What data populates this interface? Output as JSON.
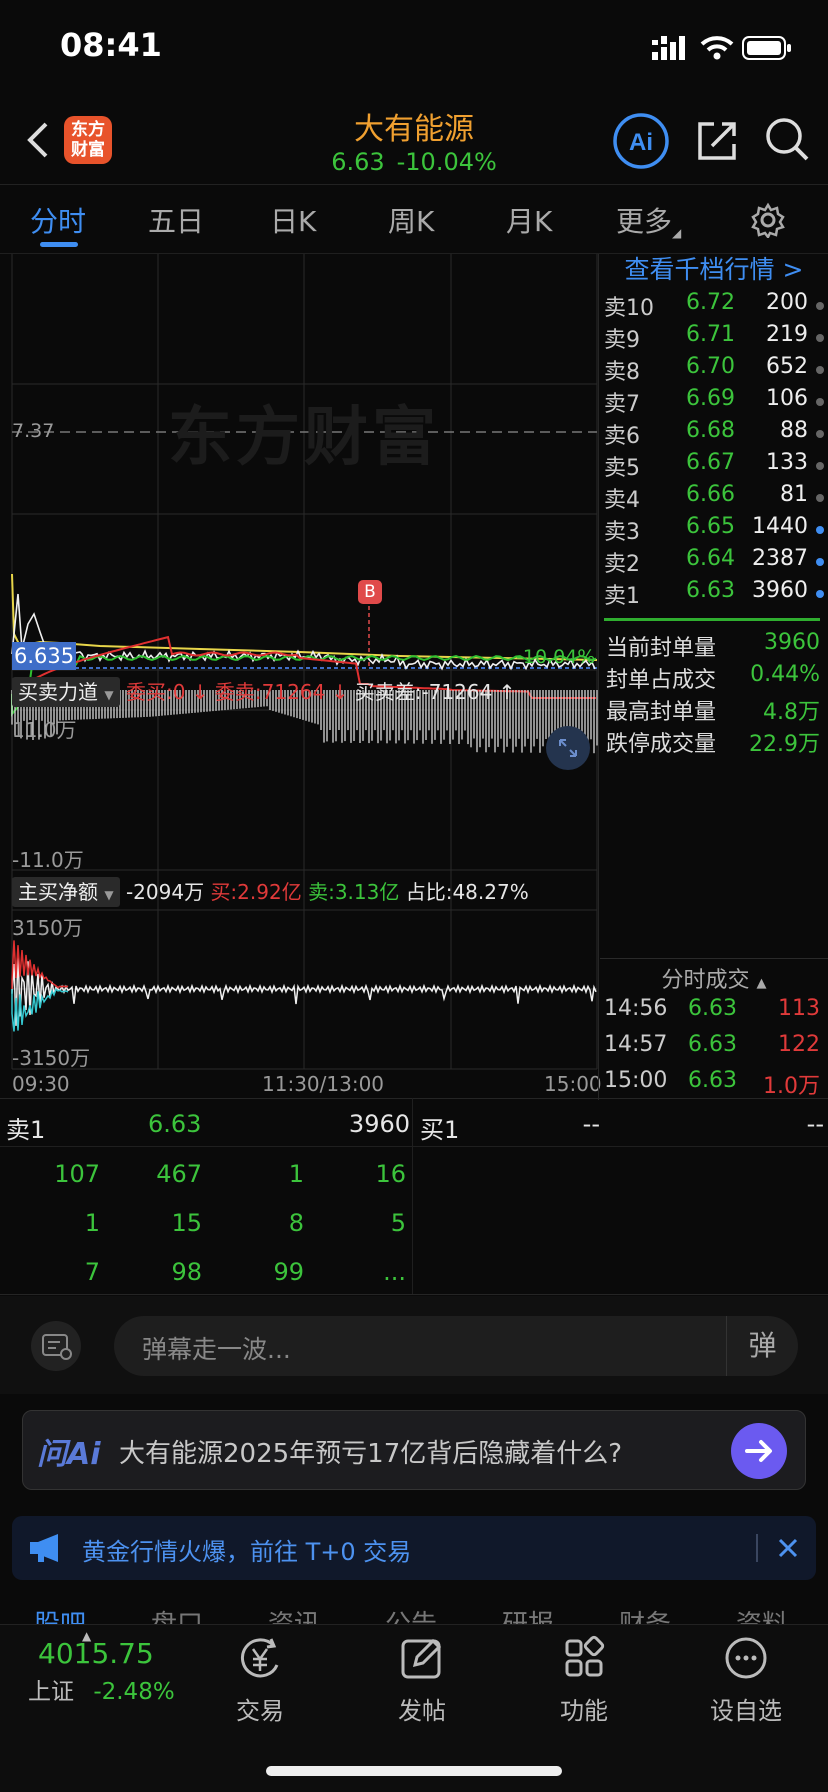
{
  "status_bar": {
    "time": "08:41"
  },
  "header": {
    "logo_text": "东方财富",
    "title": "大有能源",
    "price": "6.63",
    "change_pct": "-10.04%"
  },
  "tabs": [
    {
      "label": "分时",
      "active": true
    },
    {
      "label": "五日"
    },
    {
      "label": "日K"
    },
    {
      "label": "周K"
    },
    {
      "label": "月K"
    },
    {
      "label": "更多"
    }
  ],
  "chart": {
    "watermark": "东方财富",
    "ref_price_label": "7.37",
    "current_price_label": "6.635",
    "current_pct_label": "-10.04%",
    "marker": "B",
    "force_panel": {
      "name": "买卖力道",
      "commission_buy": "委买:0 ↓",
      "commission_sell": "委卖:71264 ↓",
      "diff": "买卖差:-71264 ↑",
      "top_label": "11.0万",
      "bottom_label": "-11.0万"
    },
    "net_panel": {
      "name": "主买净额",
      "net": "-2094万",
      "buy": "买:2.92亿",
      "sell": "卖:3.13亿",
      "ratio": "占比:48.27%",
      "top_label": "3150万",
      "bottom_label": "-3150万"
    },
    "time_axis": [
      "09:30",
      "11:30/13:00",
      "15:00"
    ]
  },
  "order_book": {
    "header": "查看千档行情 >",
    "rows": [
      {
        "label": "卖10",
        "price": "6.72",
        "vol": "200",
        "dot": "gray"
      },
      {
        "label": "卖9",
        "price": "6.71",
        "vol": "219",
        "dot": "gray"
      },
      {
        "label": "卖8",
        "price": "6.70",
        "vol": "652",
        "dot": "gray"
      },
      {
        "label": "卖7",
        "price": "6.69",
        "vol": "106",
        "dot": "gray"
      },
      {
        "label": "卖6",
        "price": "6.68",
        "vol": "88",
        "dot": "gray"
      },
      {
        "label": "卖5",
        "price": "6.67",
        "vol": "133",
        "dot": "gray"
      },
      {
        "label": "卖4",
        "price": "6.66",
        "vol": "81",
        "dot": "gray"
      },
      {
        "label": "卖3",
        "price": "6.65",
        "vol": "1440",
        "dot": "blue"
      },
      {
        "label": "卖2",
        "price": "6.64",
        "vol": "2387",
        "dot": "blue"
      },
      {
        "label": "卖1",
        "price": "6.63",
        "vol": "3960",
        "dot": "blue"
      }
    ],
    "stats": [
      {
        "k": "当前封单量",
        "v": "3960"
      },
      {
        "k": "封单占成交",
        "v": "0.44%"
      },
      {
        "k": "最高封单量",
        "v": "4.8万"
      },
      {
        "k": "跌停成交量",
        "v": "22.9万"
      }
    ]
  },
  "ticks": {
    "header": "分时成交",
    "rows": [
      {
        "t": "14:56",
        "p": "6.63",
        "q": "113"
      },
      {
        "t": "14:57",
        "p": "6.63",
        "q": "122"
      },
      {
        "t": "15:00",
        "p": "6.63",
        "q": "1.0万"
      }
    ]
  },
  "level2": {
    "sell1_label": "卖1",
    "sell1_price": "6.63",
    "sell1_vol": "3960",
    "buy1_label": "买1",
    "buy1_price": "--",
    "buy1_vol": "--",
    "queue": [
      [
        "107",
        "467",
        "1",
        "16"
      ],
      [
        "1",
        "15",
        "8",
        "5"
      ],
      [
        "7",
        "98",
        "99",
        "..."
      ]
    ]
  },
  "danmu": {
    "placeholder": "弹幕走一波...",
    "button": "弹"
  },
  "ask_ai": {
    "brand": "问Ai",
    "question": "大有能源2025年预亏17亿背后隐藏着什么?"
  },
  "promo": {
    "text": "黄金行情火爆，前往 T+0 交易"
  },
  "bottom_nav": {
    "index_value": "4015.75",
    "index_name": "上证",
    "index_change": "-2.48%",
    "items": [
      "交易",
      "发帖",
      "功能",
      "设自选"
    ],
    "hidden_tabs": [
      "股吧",
      "盘口",
      "资讯",
      "公告",
      "研报",
      "财务",
      "资料"
    ]
  }
}
